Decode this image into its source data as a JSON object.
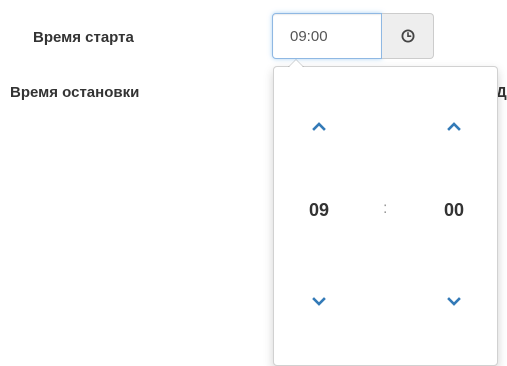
{
  "form": {
    "start_label": "Время старта",
    "stop_label": "Время остановки",
    "start_value": "09:00",
    "cut_text": "Да"
  },
  "picker": {
    "hour": "09",
    "minute": "00",
    "separator": ":"
  },
  "icons": {
    "clock": "clock-icon",
    "increment": "chevron-up-icon",
    "decrement": "chevron-down-icon"
  },
  "colors": {
    "accent": "#337ab7",
    "focus_border": "#8fb8e3",
    "addon_bg": "#eeeeee"
  }
}
